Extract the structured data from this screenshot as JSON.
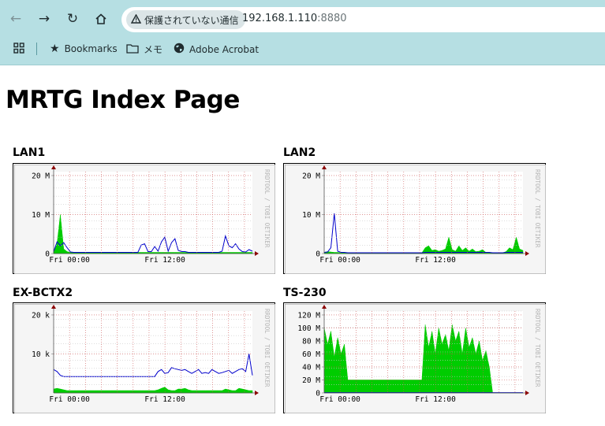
{
  "browser": {
    "security_label": "保護されていない通信",
    "url_host": "192.168.1.110",
    "url_port": ":8880",
    "bookmarks": [
      "Bookmarks",
      "メモ",
      "Adobe Acrobat"
    ]
  },
  "page": {
    "title": "MRTG Index Page"
  },
  "chart_data": [
    {
      "type": "area",
      "title": "LAN1",
      "x_tick_labels": [
        "Fri 00:00",
        "Fri 12:00"
      ],
      "y_tick_labels": [
        "0",
        "10 M",
        "20 M"
      ],
      "ylim": [
        0,
        21
      ],
      "watermark": "RRDTOOL / TOBI OETIKER",
      "series": [
        {
          "color": "#00cc00",
          "render": "area",
          "values": [
            0.4,
            2.5,
            10,
            1.2,
            0.5,
            0.3,
            0.3,
            0.3,
            0.3,
            0.3,
            0.3,
            0.3,
            0.3,
            0.3,
            0.3,
            0.3,
            0.3,
            0.3,
            0.3,
            0.3,
            0.3,
            0.3,
            0.3,
            0.3,
            0.3,
            0.3,
            0.3,
            0.3,
            0.3,
            0.3,
            0.3,
            0.3,
            0.3,
            0.3,
            0.3,
            0.3,
            0.3,
            0.3,
            0.3,
            0.3,
            0.3,
            0.3,
            0.3,
            0.3,
            0.3,
            0.3,
            0.3,
            0.3,
            0.3,
            0.3,
            0.3,
            0.3,
            0.3,
            0.3,
            0.3,
            0.3,
            0.3,
            0.3,
            0.3,
            0.3
          ]
        },
        {
          "color": "#0000cc",
          "render": "line",
          "values": [
            0.5,
            3,
            2,
            2.8,
            1.5,
            0.4,
            0.3,
            0.3,
            0.3,
            0.3,
            0.3,
            0.3,
            0.3,
            0.3,
            0.3,
            0.3,
            0.3,
            0.3,
            0.3,
            0.3,
            0.3,
            0.3,
            0.3,
            0.3,
            0.3,
            0.3,
            2.2,
            2.5,
            0.5,
            0.5,
            1.8,
            0.6,
            3,
            4.2,
            0.6,
            2.8,
            3.8,
            0.8,
            0.5,
            0.5,
            0.3,
            0.3,
            0.3,
            0.3,
            0.3,
            0.3,
            0.3,
            0.3,
            0.3,
            0.3,
            0.6,
            4.5,
            2,
            1.5,
            2.5,
            1.2,
            0.5,
            0.4,
            1,
            0.6
          ]
        }
      ]
    },
    {
      "type": "area",
      "title": "LAN2",
      "x_tick_labels": [
        "Fri 00:00",
        "Fri 12:00"
      ],
      "y_tick_labels": [
        "0",
        "10 M",
        "20 M"
      ],
      "ylim": [
        0,
        21
      ],
      "watermark": "RRDTOOL / TOBI OETIKER",
      "series": [
        {
          "color": "#00cc00",
          "render": "area",
          "values": [
            0.3,
            0.5,
            0.4,
            0.3,
            0.3,
            0.2,
            0.2,
            0.2,
            0.2,
            0.2,
            0.2,
            0.2,
            0.2,
            0.2,
            0.2,
            0.2,
            0.2,
            0.2,
            0.2,
            0.2,
            0.2,
            0.2,
            0.2,
            0.2,
            0.2,
            0.2,
            0.2,
            0.2,
            0.2,
            0.2,
            1.5,
            2,
            0.8,
            1,
            0.6,
            0.8,
            1.2,
            4.2,
            1,
            0.6,
            2,
            0.8,
            1.5,
            0.6,
            1.2,
            0.5,
            0.6,
            1,
            0.3,
            0.3,
            0.2,
            0.2,
            0.2,
            0.2,
            0.5,
            1.5,
            1,
            4.2,
            1.2,
            0.8
          ]
        },
        {
          "color": "#0000cc",
          "render": "line",
          "values": [
            0.3,
            0.4,
            1.5,
            10.3,
            0.6,
            0.3,
            0.3,
            0.2,
            0.2,
            0.2,
            0.2,
            0.2,
            0.2,
            0.2,
            0.2,
            0.2,
            0.2,
            0.2,
            0.2,
            0.2,
            0.2,
            0.2,
            0.2,
            0.2,
            0.2,
            0.2,
            0.2,
            0.2,
            0.2,
            0.2,
            0.3,
            0.3,
            0.3,
            0.3,
            0.3,
            0.3,
            0.3,
            0.3,
            0.3,
            0.3,
            0.3,
            0.3,
            0.3,
            0.3,
            0.3,
            0.3,
            0.3,
            0.3,
            0.3,
            0.3,
            0.2,
            0.2,
            0.2,
            0.2,
            0.3,
            0.3,
            0.3,
            0.3,
            0.3,
            0.3
          ]
        }
      ]
    },
    {
      "type": "area",
      "title": "EX-BCTX2",
      "x_tick_labels": [
        "Fri 00:00",
        "Fri 12:00"
      ],
      "y_tick_labels": [
        "10 k",
        "20 k"
      ],
      "ylim": [
        0,
        21
      ],
      "watermark": "RRDTOOL / TOBI OETIKER",
      "series": [
        {
          "color": "#00cc00",
          "render": "area",
          "values": [
            1,
            1.2,
            1,
            0.8,
            0.6,
            0.6,
            0.6,
            0.6,
            0.6,
            0.6,
            0.6,
            0.6,
            0.6,
            0.6,
            0.6,
            0.6,
            0.6,
            0.6,
            0.6,
            0.6,
            0.6,
            0.6,
            0.6,
            0.6,
            0.6,
            0.6,
            0.6,
            0.6,
            0.6,
            0.6,
            0.6,
            0.8,
            1.2,
            1.5,
            0.8,
            0.6,
            0.6,
            1,
            1,
            1.2,
            0.8,
            0.6,
            0.6,
            0.6,
            0.6,
            0.6,
            0.6,
            0.6,
            0.6,
            0.6,
            0.6,
            1,
            0.8,
            0.6,
            0.6,
            1.2,
            1,
            0.8,
            0.6,
            0.6
          ]
        },
        {
          "color": "#0000cc",
          "render": "line",
          "values": [
            6,
            5.5,
            4.5,
            4.2,
            4.2,
            4.2,
            4.2,
            4.2,
            4.2,
            4.2,
            4.2,
            4.2,
            4.2,
            4.2,
            4.2,
            4.2,
            4.2,
            4.2,
            4.2,
            4.2,
            4.2,
            4.2,
            4.2,
            4.2,
            4.2,
            4.2,
            4.2,
            4.2,
            4.2,
            4.2,
            4.2,
            5.5,
            6,
            5,
            5.2,
            6.5,
            6.2,
            6,
            5.8,
            6,
            5.5,
            5,
            5.5,
            6,
            5,
            5.2,
            5,
            6,
            5.5,
            5,
            5.2,
            5.5,
            5.8,
            5,
            5.5,
            6,
            6.2,
            5.5,
            10,
            4.5
          ]
        }
      ]
    },
    {
      "type": "area",
      "title": "TS-230",
      "x_tick_labels": [
        "Fri 00:00",
        "Fri 12:00"
      ],
      "y_tick_labels": [
        "0",
        "20 M",
        "40 M",
        "60 M",
        "80 M",
        "100 M",
        "120 M"
      ],
      "ylim": [
        0,
        126
      ],
      "watermark": "RRDTOOL / TOBI OETIKER",
      "series": [
        {
          "color": "#00cc00",
          "render": "area",
          "values": [
            100,
            75,
            95,
            55,
            85,
            60,
            75,
            20,
            20,
            20,
            20,
            20,
            20,
            20,
            20,
            20,
            20,
            20,
            20,
            20,
            20,
            20,
            20,
            20,
            20,
            20,
            20,
            20,
            20,
            20,
            105,
            70,
            95,
            60,
            100,
            75,
            90,
            65,
            105,
            80,
            95,
            60,
            100,
            70,
            85,
            60,
            80,
            50,
            65,
            40,
            0,
            0,
            0,
            0,
            0,
            0,
            0,
            0,
            0,
            0
          ]
        },
        {
          "color": "#0000cc",
          "render": "line",
          "values": [
            0.5,
            0.5,
            0.5,
            0.5,
            0.5,
            0.5,
            0.5,
            0.5,
            0.5,
            0.5,
            0.5,
            0.5,
            0.5,
            0.5,
            0.5,
            0.5,
            0.5,
            0.5,
            0.5,
            0.5,
            0.5,
            0.5,
            0.5,
            0.5,
            0.5,
            0.5,
            0.5,
            0.5,
            0.5,
            0.5,
            0.5,
            0.5,
            0.5,
            0.5,
            0.5,
            0.5,
            0.5,
            0.5,
            0.5,
            0.5,
            0.5,
            0.5,
            0.5,
            0.5,
            0.5,
            0.5,
            0.5,
            0.5,
            0.5,
            0.5,
            0.5,
            0.5,
            0.5,
            0.5,
            0.5,
            0.5,
            0.5,
            0.5,
            0.5,
            0.5
          ]
        }
      ]
    }
  ]
}
